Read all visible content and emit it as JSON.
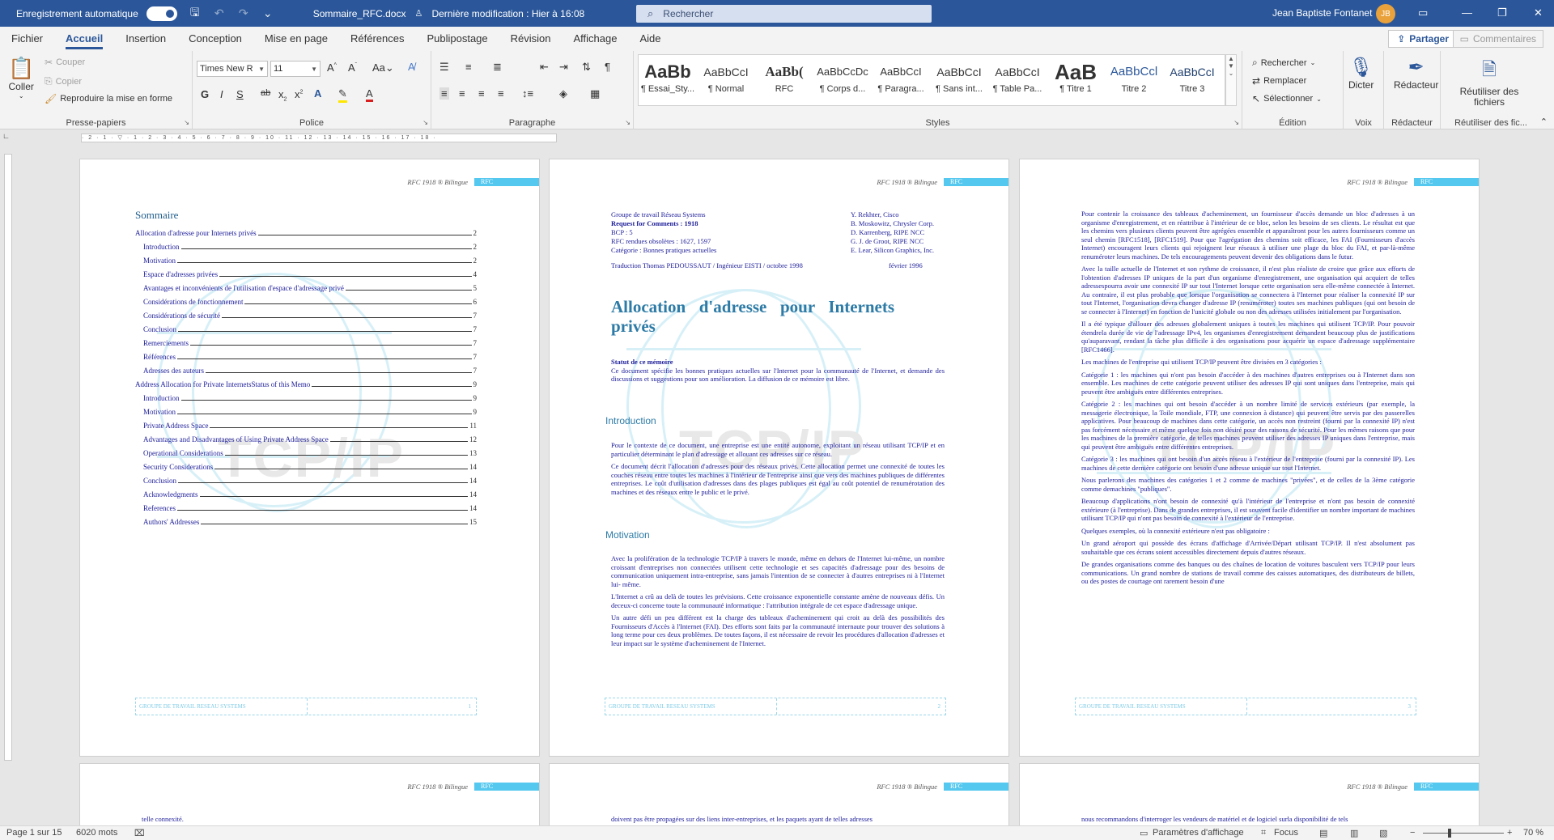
{
  "titlebar": {
    "autosave_label": "Enregistrement automatique",
    "autosave_state": "Activé",
    "doc_name": "Sommaire_RFC.docx",
    "last_modified": "Dernière modification : Hier à 16:08",
    "search_placeholder": "Rechercher",
    "user_name": "Jean Baptiste Fontanet",
    "user_initials": "JB"
  },
  "menu": {
    "tabs": [
      "Fichier",
      "Accueil",
      "Insertion",
      "Conception",
      "Mise en page",
      "Références",
      "Publipostage",
      "Révision",
      "Affichage",
      "Aide"
    ],
    "active": "Accueil",
    "share": "Partager",
    "comments": "Commentaires"
  },
  "ribbon": {
    "clipboard": {
      "paste": "Coller",
      "cut": "Couper",
      "copy": "Copier",
      "format_painter": "Reproduire la mise en forme",
      "label": "Presse-papiers"
    },
    "font": {
      "name": "Times New R",
      "size": "11",
      "label": "Police"
    },
    "paragraph": {
      "label": "Paragraphe"
    },
    "styles": {
      "label": "Styles",
      "items": [
        {
          "sample": "AaBb",
          "name": "¶ Essai_Sty..."
        },
        {
          "sample": "AaBbCcI",
          "name": "¶ Normal"
        },
        {
          "sample": "AaBb(",
          "name": "RFC"
        },
        {
          "sample": "AaBbCcDc",
          "name": "¶ Corps d..."
        },
        {
          "sample": "AaBbCcI",
          "name": "¶ Paragra..."
        },
        {
          "sample": "AaBbCcI",
          "name": "¶ Sans int..."
        },
        {
          "sample": "AaBbCcI",
          "name": "¶ Table Pa..."
        },
        {
          "sample": "AaB",
          "name": "¶ Titre 1"
        },
        {
          "sample": "AaBbCcl",
          "name": "Titre 2"
        },
        {
          "sample": "AaBbCcI",
          "name": "Titre 3"
        }
      ]
    },
    "editing": {
      "find": "Rechercher",
      "replace": "Remplacer",
      "select": "Sélectionner",
      "label": "Édition"
    },
    "voice": {
      "dictate": "Dicter",
      "label": "Voix"
    },
    "editor": {
      "editor": "Rédacteur",
      "label": "Rédacteur"
    },
    "reuse": {
      "reuse": "Réutiliser des fichiers",
      "label": "Réutiliser des fic..."
    }
  },
  "ruler_text": "· 2 · 1 · ▽ · 1 · 2 · 3 · 4 · 5 · 6 · 7 · 8 · 9 · 10 · 11 · 12 · 13 · 14 · 15 · 16 · 17 · 18 ·",
  "page_header": {
    "text": "RFC 1918 ® Bilingue",
    "tag": "RFC"
  },
  "footer_text": "GROUPE DE TRAVAIL RESEAU SYSTEMS",
  "watermark": "TCP/IP",
  "page1": {
    "page_num": "1",
    "toc_title": "Sommaire",
    "toc": [
      {
        "text": "Allocation d'adresse pour Internets privés",
        "page": "2",
        "indent": 0
      },
      {
        "text": "Introduction",
        "page": "2",
        "indent": 1
      },
      {
        "text": "Motivation",
        "page": "2",
        "indent": 1
      },
      {
        "text": "Espace d'adresses privées",
        "page": "4",
        "indent": 1
      },
      {
        "text": "Avantages et inconvénients de l'utilisation d'espace d'adressage privé",
        "page": "5",
        "indent": 1
      },
      {
        "text": "Considérations de fonctionnement",
        "page": "6",
        "indent": 1
      },
      {
        "text": "Considérations de sécurité",
        "page": "7",
        "indent": 1
      },
      {
        "text": "Conclusion",
        "page": "7",
        "indent": 1
      },
      {
        "text": "Remerciements",
        "page": "7",
        "indent": 1
      },
      {
        "text": "Références",
        "page": "7",
        "indent": 1
      },
      {
        "text": "Adresses des auteurs",
        "page": "7",
        "indent": 1
      },
      {
        "text": "Address Allocation for Private InternetsStatus of this Memo",
        "page": "9",
        "indent": 0
      },
      {
        "text": "Introduction",
        "page": "9",
        "indent": 1
      },
      {
        "text": "Motivation",
        "page": "9",
        "indent": 1
      },
      {
        "text": "Private Address Space",
        "page": "11",
        "indent": 1
      },
      {
        "text": "Advantages and Disadvantages of Using Private Address Space",
        "page": "12",
        "indent": 1
      },
      {
        "text": "Operational Considerations",
        "page": "13",
        "indent": 1
      },
      {
        "text": "Security Considerations",
        "page": "14",
        "indent": 1
      },
      {
        "text": "Conclusion",
        "page": "14",
        "indent": 1
      },
      {
        "text": "Acknowledgments",
        "page": "14",
        "indent": 1
      },
      {
        "text": "References",
        "page": "14",
        "indent": 1
      },
      {
        "text": "Authors' Addresses",
        "page": "15",
        "indent": 1
      }
    ]
  },
  "page2": {
    "page_num": "2",
    "meta_left": [
      "Groupe de travail Réseau Systems",
      "Request for Comments : 1918",
      "BCP : 5",
      "RFC rendues obsolètes : 1627, 1597",
      "Catégorie : Bonnes pratiques actuelles"
    ],
    "meta_right": [
      "Y. Rekhter, Cisco",
      "B. Moskowitz, Chrysler Corp.",
      "D. Karrenberg, RIPE NCC",
      "G. J. de Groot, RIPE NCC",
      "E. Lear, Silicon Graphics, Inc."
    ],
    "translation": "Traduction Thomas PEDOUSSAUT / Ingénieur EISTI / octobre 1998",
    "date": "février 1996",
    "title": "Allocation d'adresse pour Internets privés",
    "status_head": "Statut de ce mémoire",
    "status_text": "Ce document spécifie les bonnes pratiques actuelles sur l'Internet pour la communauté de l'Internet, et demande des discussions et suggestions pour son amélioration. La diffusion de ce mémoire est libre.",
    "intro_head": "Introduction",
    "intro": [
      "Pour le contexte de ce document, une entreprise est une entité autonome, exploitant un réseau utilisant TCP/IP et en particulier déterminant le plan d'adressage et allouant ces adresses sur ce réseau.",
      "Ce document décrit l'allocation d'adresses pour des réseaux privés. Cette allocation permet une connexité de toutes les couches réseau entre toutes les machines à l'intérieur de l'entreprise ainsi que vers des machines publiques de différentes entreprises. Le coût d'utilisation d'adresses dans des plages publiques est égal au coût potentiel de renumérotation des machines et des réseaux entre le public et le privé."
    ],
    "motivation_head": "Motivation",
    "motivation": [
      "Avec la prolifération de la technologie TCP/IP à travers le monde, même en dehors de l'Internet lui-même, un nombre croissant d'entreprises non connectées utilisent cette technologie et ses capacités d'adressage pour des besoins de communication uniquement intra-entreprise, sans jamais l'intention de se connecter à d'autres entreprises ni à l'Internet lui- même.",
      "L'Internet a crû au delà de toutes les prévisions. Cette croissance exponentielle constante amène de nouveaux défis. Un deceux-ci concerne toute la communauté informatique : l'attribution intégrale de cet espace d'adressage unique.",
      "Un autre défi un peu différent est la charge des tableaux d'acheminement qui croit au delà des possibilités des Fournisseurs d'Accès à l'Internet (FAI). Des efforts sont faits par la communauté internaute pour trouver des solutions à long terme pour ces deux problèmes. De toutes façons, il est nécessaire de revoir les procédures d'allocation d'adresses et leur impact sur le système d'acheminement de l'Internet."
    ]
  },
  "page3": {
    "page_num": "3",
    "paras": [
      "Pour contenir la croissance des tableaux d'acheminement, un fournisseur d'accès demande un bloc d'adresses à un organisme d'enregistrement, et en réattribue à l'intérieur de ce bloc, selon les besoins de ses clients. Le résultat est que les chemins vers plusieurs clients peuvent être agrégées ensemble et apparaîtront pour les autres fournisseurs comme un seul chemin [RFC1518], [RFC1519]. Pour que l'agrégation des chemins soit efficace, les FAI (Fournisseurs d'accès Internet) encouragent leurs clients qui rejoignent leur réseaux à utiliser une plage du bloc du FAI, et par-là-même renuméroter leurs machines. De tels encouragements peuvent devenir des obligations dans le futur.",
      "Avec la taille actuelle de l'Internet et son rythme de croissance, il n'est plus réaliste de croire que grâce aux efforts de l'obtention d'adresses IP uniques de la part d'un organisme d'enregistrement, une organisation qui acquiert de telles adressespourra avoir une connexité IP sur tout l'Internet lorsque cette organisation sera elle-même connectée à Internet. Au contraire, il est plus probable que lorsque l'organisation se connectera à l'Internet pour réaliser la connexité IP sur tout l'Internet, l'organisation devra changer d'adresse IP (renuméroter) toutes ses machines publiques (qui ont besoin de se connecter à l'Internet) en fonction de l'unicité globale ou non des adresses utilisées initialement par l'organisation.",
      "Il a été typique d'allouer des adresses globalement uniques à toutes les machines qui utilisent TCP/IP. Pour pouvoir étendrela durée de vie de l'adressage IPv4, les organismes d'enregistrement demandent beaucoup plus de justifications qu'auparavant, rendant la tâche plus difficile à des organisations pour acquérir un espace d'adressage supplémentaire [RFC1466].",
      "Les machines de l'entreprise qui utilisent TCP/IP peuvent être divisées en 3 catégories :",
      "Catégorie 1 : les machines qui n'ont pas besoin d'accéder à des machines d'autres entreprises ou à l'Internet dans son ensemble. Les machines de cette catégorie peuvent utiliser des adresses IP qui sont uniques dans l'entreprise, mais qui peuvent être ambiguës entre différentes entreprises.",
      "Catégorie 2 : les machines qui ont besoin d'accéder à un nombre limité de services extérieurs (par exemple, la messagerie électronique, la Toile mondiale, FTP, une connexion à distance) qui peuvent être servis par des passerelles applicatives. Pour beaucoup de machines dans cette catégorie, un accès non restreint (fourni par la connexité IP) n'est pas forcément nécessaire et même quelque fois non désiré pour des raisons de sécurité. Pour les mêmes raisons que pour les machines de la première catégorie, de telles machines peuvent utiliser des adresses IP uniques dans l'entreprise, mais qui peuvent être ambiguës entre différentes entreprises.",
      "Catégorie 3 : les machines qui ont besoin d'un accès réseau à l'extérieur de l'entreprise (fourni par la connexité IP). Les machines de cette dernière catégorie ont besoin d'une adresse unique sur tout l'Internet.",
      "Nous parlerons des machines des catégories 1 et 2 comme de machines \"privées\", et de celles de la 3ème catégorie comme demachines \"publiques\".",
      "Beaucoup d'applications n'ont besoin de connexité qu'à l'intérieur de l'entreprise et n'ont pas besoin de connexité extérieure (à l'entreprise). Dans de grandes entreprises, il est souvent facile d'identifier un nombre important de machines utilisant TCP/IP qui n'ont pas besoin de connexité à l'extérieur de l'entreprise.",
      "Quelques exemples, où la connexité extérieure n'est pas obligatoire :",
      "Un grand aéroport qui possède des écrans d'affichage d'Arrivée/Départ utilisant TCP/IP. Il n'est absolument pas souhaitable que ces écrans soient accessibles directement depuis d'autres réseaux.",
      "De grandes organisations comme des banques ou des chaînes de location de voitures basculent vers TCP/IP pour leurs communications. Un grand nombre de stations de travail comme des caisses automatiques, des distributeurs de billets, ou des postes de courtage ont rarement besoin d'une"
    ]
  },
  "page4_text": "telle connexité.",
  "page5_text": "doivent pas être propagées sur des liens inter-entreprises, et les paquets ayant de telles adresses",
  "page6_text": "nous recommandons d'interroger les vendeurs de matériel et de logiciel surla disponibilité de tels",
  "status": {
    "page": "Page 1 sur 15",
    "words": "6020 mots",
    "display_settings": "Paramètres d'affichage",
    "focus": "Focus",
    "zoom": "70 %"
  }
}
